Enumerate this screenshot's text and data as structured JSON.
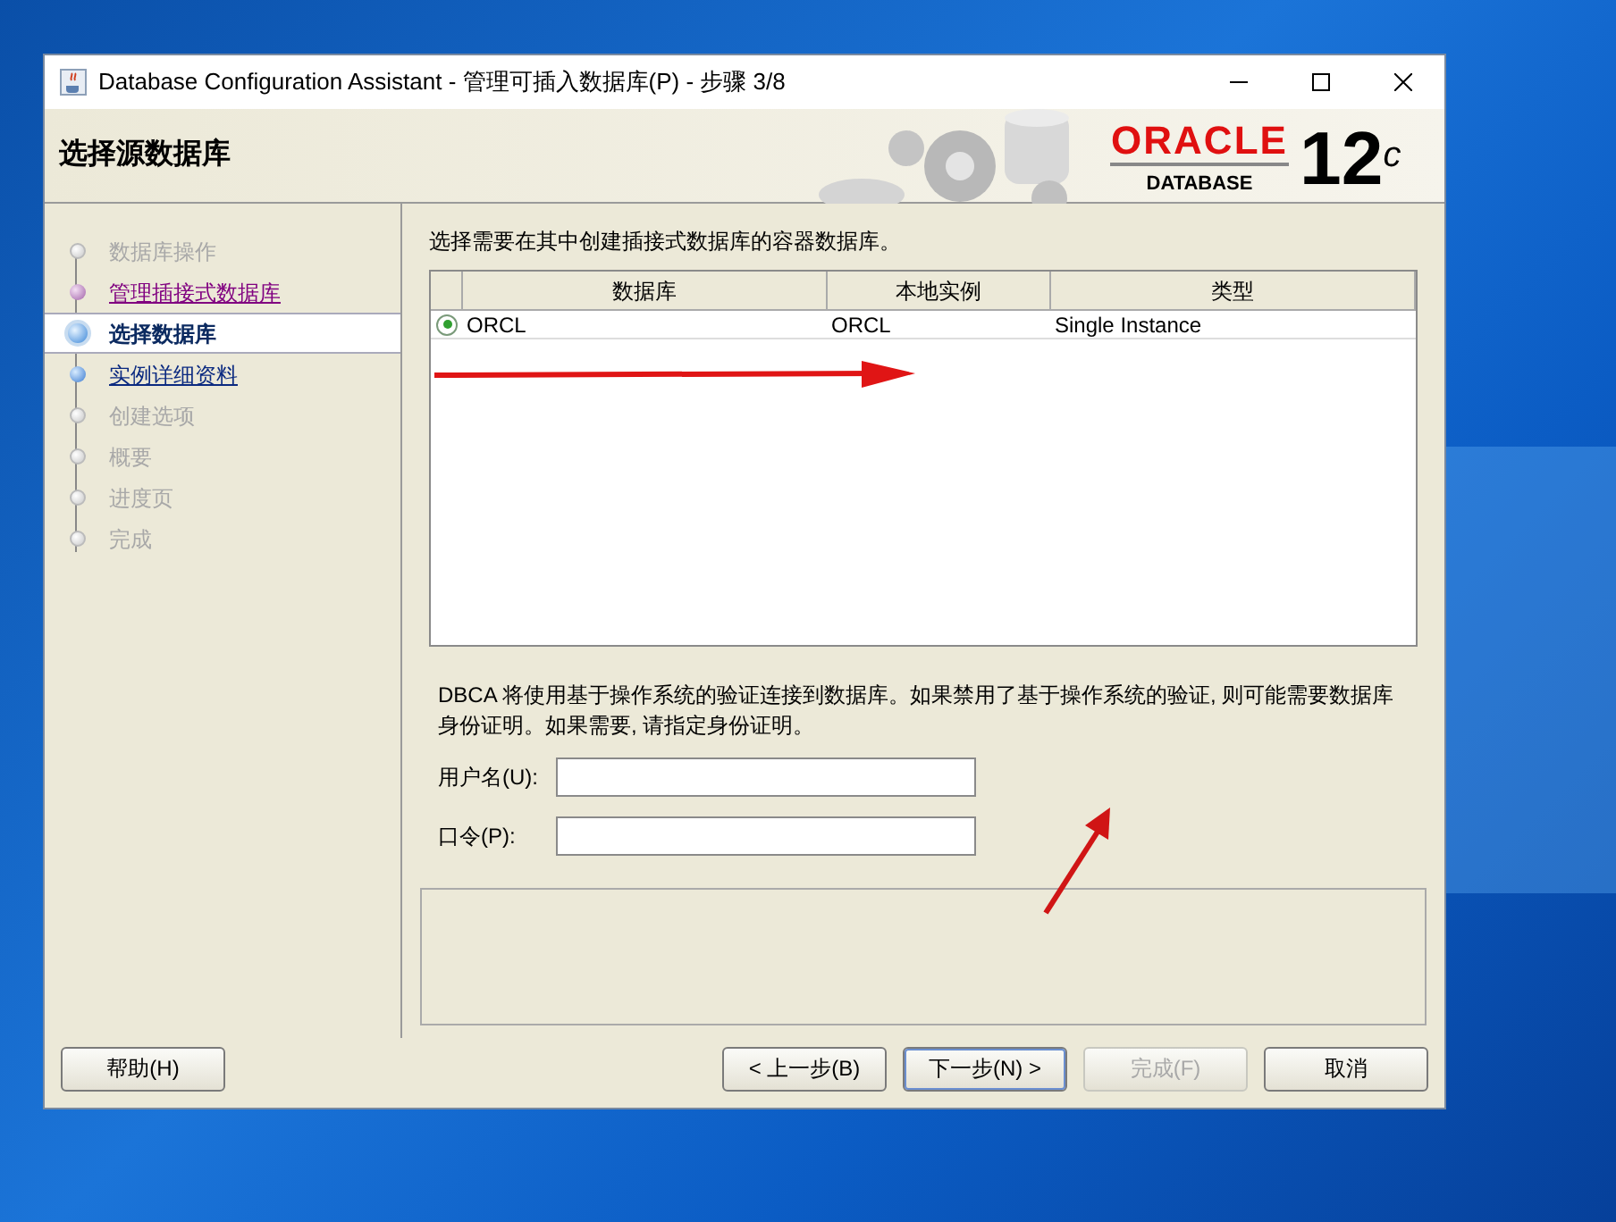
{
  "window": {
    "title": "Database Configuration Assistant - 管理可插入数据库(P) - 步骤 3/8"
  },
  "header": {
    "title": "选择源数据库",
    "logo": {
      "brand": "ORACLE",
      "product": "DATABASE",
      "version": "12$^{c}$"
    }
  },
  "steps": [
    {
      "label": "数据库操作",
      "kind": "pending"
    },
    {
      "label": "管理插接式数据库",
      "kind": "visited"
    },
    {
      "label": "选择数据库",
      "kind": "current"
    },
    {
      "label": "实例详细资料",
      "kind": "next"
    },
    {
      "label": "创建选项",
      "kind": "pending"
    },
    {
      "label": "概要",
      "kind": "pending"
    },
    {
      "label": "进度页",
      "kind": "pending"
    },
    {
      "label": "完成",
      "kind": "pending"
    }
  ],
  "intro": "选择需要在其中创建插接式数据库的容器数据库。",
  "table": {
    "columns": [
      "数据库",
      "本地实例",
      "类型"
    ],
    "rows": [
      {
        "selected": true,
        "cells": [
          "ORCL",
          "ORCL",
          "Single Instance"
        ]
      }
    ]
  },
  "auth_note": "DBCA 将使用基于操作系统的验证连接到数据库。如果禁用了基于操作系统的验证, 则可能需要数据库身份证明。如果需要, 请指定身份证明。",
  "fields": [
    {
      "label": "用户名(U):"
    },
    {
      "label": "口令(P):"
    }
  ],
  "buttons": [
    {
      "label": "帮助(H)",
      "kind": "help",
      "disabled": false,
      "default": false
    },
    {
      "label": "< 上一步(B)",
      "kind": "wizard",
      "disabled": false,
      "default": false
    },
    {
      "label": "下一步(N) >",
      "kind": "wizard",
      "disabled": false,
      "default": true
    },
    {
      "label": "完成(F)",
      "kind": "wizard",
      "disabled": true,
      "default": false
    },
    {
      "label": "取消",
      "kind": "wizard",
      "disabled": false,
      "default": false
    }
  ]
}
